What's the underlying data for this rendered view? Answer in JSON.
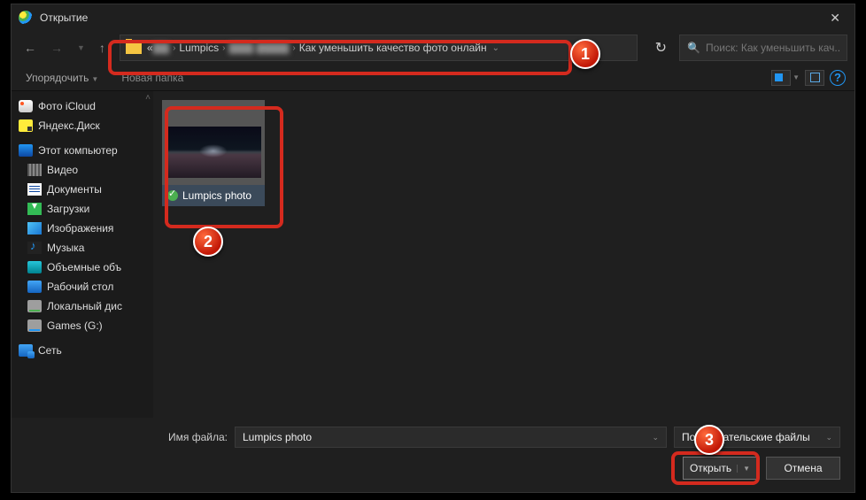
{
  "title": "Открытие",
  "breadcrumb": {
    "prefix": "«",
    "seg_blur1": "▇▇",
    "seg1": "Lumpics",
    "seg_blur2": "▇▇▇  ▇▇▇▇",
    "seg2": "Как уменьшить качество фото онлайн"
  },
  "search": {
    "placeholder": "Поиск: Как уменьшить кач..."
  },
  "toolbar": {
    "organize": "Упорядочить",
    "newfolder": "Новая папка"
  },
  "sidebar": {
    "items": [
      {
        "label": "Фото iCloud",
        "cls": "ic-icloud",
        "top": true
      },
      {
        "label": "Яндекс.Диск",
        "cls": "ic-yd",
        "top": true
      },
      {
        "label": "Этот компьютер",
        "cls": "ic-pc",
        "top": true
      },
      {
        "label": "Видео",
        "cls": "ic-vid"
      },
      {
        "label": "Документы",
        "cls": "ic-doc"
      },
      {
        "label": "Загрузки",
        "cls": "ic-dl"
      },
      {
        "label": "Изображения",
        "cls": "ic-img"
      },
      {
        "label": "Музыка",
        "cls": "ic-mus"
      },
      {
        "label": "Объемные объ",
        "cls": "ic-3d"
      },
      {
        "label": "Рабочий стол",
        "cls": "ic-desk"
      },
      {
        "label": "Локальный дис",
        "cls": "ic-disk"
      },
      {
        "label": "Games (G:)",
        "cls": "ic-gm"
      },
      {
        "label": "Сеть",
        "cls": "ic-net",
        "top": true
      }
    ]
  },
  "file": {
    "name": "Lumpics photo"
  },
  "footer": {
    "fname_label": "Имя файла:",
    "fname_value": "Lumpics photo",
    "ftype_value": "Пользовательские файлы",
    "open": "Открыть",
    "cancel": "Отмена"
  },
  "annotations": {
    "b1": "1",
    "b2": "2",
    "b3": "3"
  }
}
